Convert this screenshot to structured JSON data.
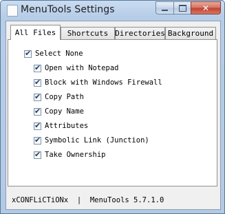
{
  "window": {
    "title": "MenuTools Settings",
    "close_glyph": "✕"
  },
  "tabs": [
    {
      "label": "All Files",
      "active": true
    },
    {
      "label": "Shortcuts",
      "active": false
    },
    {
      "label": "Directories",
      "active": false
    },
    {
      "label": "Background",
      "active": false
    }
  ],
  "options": {
    "select_none": {
      "label": "Select None",
      "checked": true
    },
    "items": [
      {
        "label": "Open with Notepad",
        "checked": true
      },
      {
        "label": "Block with Windows Firewall",
        "checked": true
      },
      {
        "label": "Copy Path",
        "checked": true
      },
      {
        "label": "Copy Name",
        "checked": true
      },
      {
        "label": "Attributes",
        "checked": true
      },
      {
        "label": "Symbolic Link (Junction)",
        "checked": true
      },
      {
        "label": "Take Ownership",
        "checked": true
      }
    ]
  },
  "status": {
    "author": "xCONFLiCTiONx",
    "separator": "|",
    "version": "MenuTools 5.7.1.0"
  },
  "icons": {
    "check": "✔"
  }
}
